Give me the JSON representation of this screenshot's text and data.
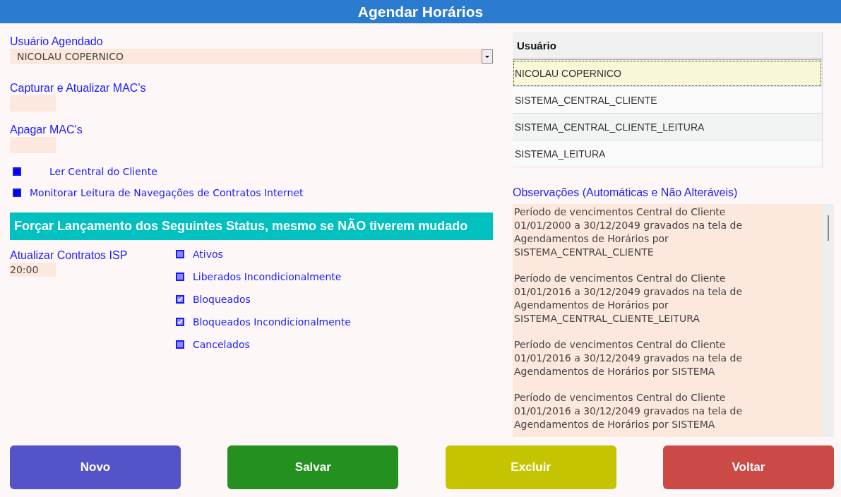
{
  "window": {
    "title": "Agendar Horários"
  },
  "user_field": {
    "label": "Usuário Agendado",
    "value": "NICOLAU COPERNICO"
  },
  "capture_macs": {
    "label": "Capturar e Atualizar MAC's"
  },
  "delete_macs": {
    "label": "Apagar MAC's"
  },
  "options": [
    {
      "label": "Ler Central do Cliente",
      "checked": true
    },
    {
      "label": "Monitorar Leitura de Navegações de Contratos Internet",
      "checked": true
    }
  ],
  "force_banner": "Forçar Lançamento dos Seguintes Status, mesmo se NÃO tiverem mudado",
  "isp_update": {
    "label": "Atualizar Contratos ISP",
    "value": "20:00"
  },
  "statuses": [
    {
      "label": "Ativos",
      "checked": false
    },
    {
      "label": "Liberados Incondicionalmente",
      "checked": false
    },
    {
      "label": "Bloqueados",
      "checked": true
    },
    {
      "label": "Bloqueados Incondicionalmente",
      "checked": true
    },
    {
      "label": "Cancelados",
      "checked": false
    }
  ],
  "table": {
    "columns": [
      "Usuário"
    ],
    "rows": [
      {
        "cells": [
          "NICOLAU COPERNICO"
        ],
        "selected": true
      },
      {
        "cells": [
          "SISTEMA_CENTRAL_CLIENTE"
        ],
        "selected": false
      },
      {
        "cells": [
          "SISTEMA_CENTRAL_CLIENTE_LEITURA"
        ],
        "selected": false
      },
      {
        "cells": [
          "SISTEMA_LEITURA"
        ],
        "selected": false
      }
    ]
  },
  "observations": {
    "label": "Observações (Automáticas e Não Alteráveis)",
    "paragraphs": [
      [
        "Período de vencimentos Central do Cliente",
        "01/01/2000 a 30/12/2049 gravados na tela de",
        "Agendamentos de Horários por",
        "SISTEMA_CENTRAL_CLIENTE"
      ],
      [
        "Período de vencimentos Central do Cliente",
        "01/01/2016 a 30/12/2049 gravados na tela de",
        "Agendamentos de Horários por",
        "SISTEMA_CENTRAL_CLIENTE_LEITURA"
      ],
      [
        "Período de vencimentos Central do Cliente",
        "01/01/2016 a 30/12/2049 gravados na tela de",
        "Agendamentos de Horários por SISTEMA"
      ],
      [
        "Período de vencimentos Central do Cliente",
        "01/01/2016 a 30/12/2049 gravados na tela de",
        "Agendamentos de Horários por SISTEMA"
      ]
    ]
  },
  "buttons": [
    {
      "label": "Novo",
      "kind": "new"
    },
    {
      "label": "Salvar",
      "kind": "save"
    },
    {
      "label": "Excluir",
      "kind": "delete"
    },
    {
      "label": "Voltar",
      "kind": "back"
    }
  ]
}
